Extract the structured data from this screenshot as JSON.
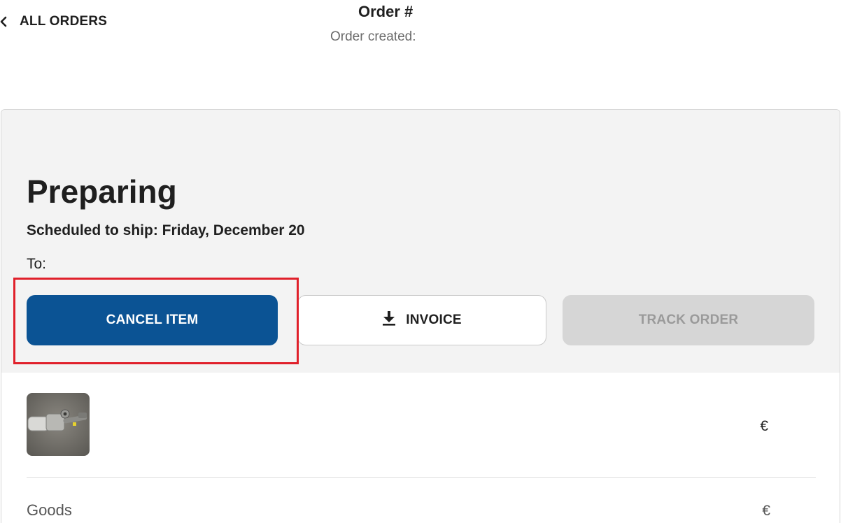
{
  "nav": {
    "back_label": "ALL ORDERS"
  },
  "order": {
    "title": "Order #",
    "created": "Order created:"
  },
  "status": {
    "title": "Preparing",
    "ship_line": "Scheduled to ship: Friday, December 20",
    "to_line": "To:"
  },
  "actions": {
    "cancel_label": "CANCEL ITEM",
    "invoice_label": "INVOICE",
    "track_label": "TRACK ORDER"
  },
  "item": {
    "price": "€"
  },
  "summary": {
    "goods_label": "Goods",
    "goods_value": "€"
  },
  "colors": {
    "primary": "#0b5394",
    "highlight": "#e0202a",
    "panel_bg": "#f3f3f3",
    "disabled_bg": "#d6d6d6"
  }
}
